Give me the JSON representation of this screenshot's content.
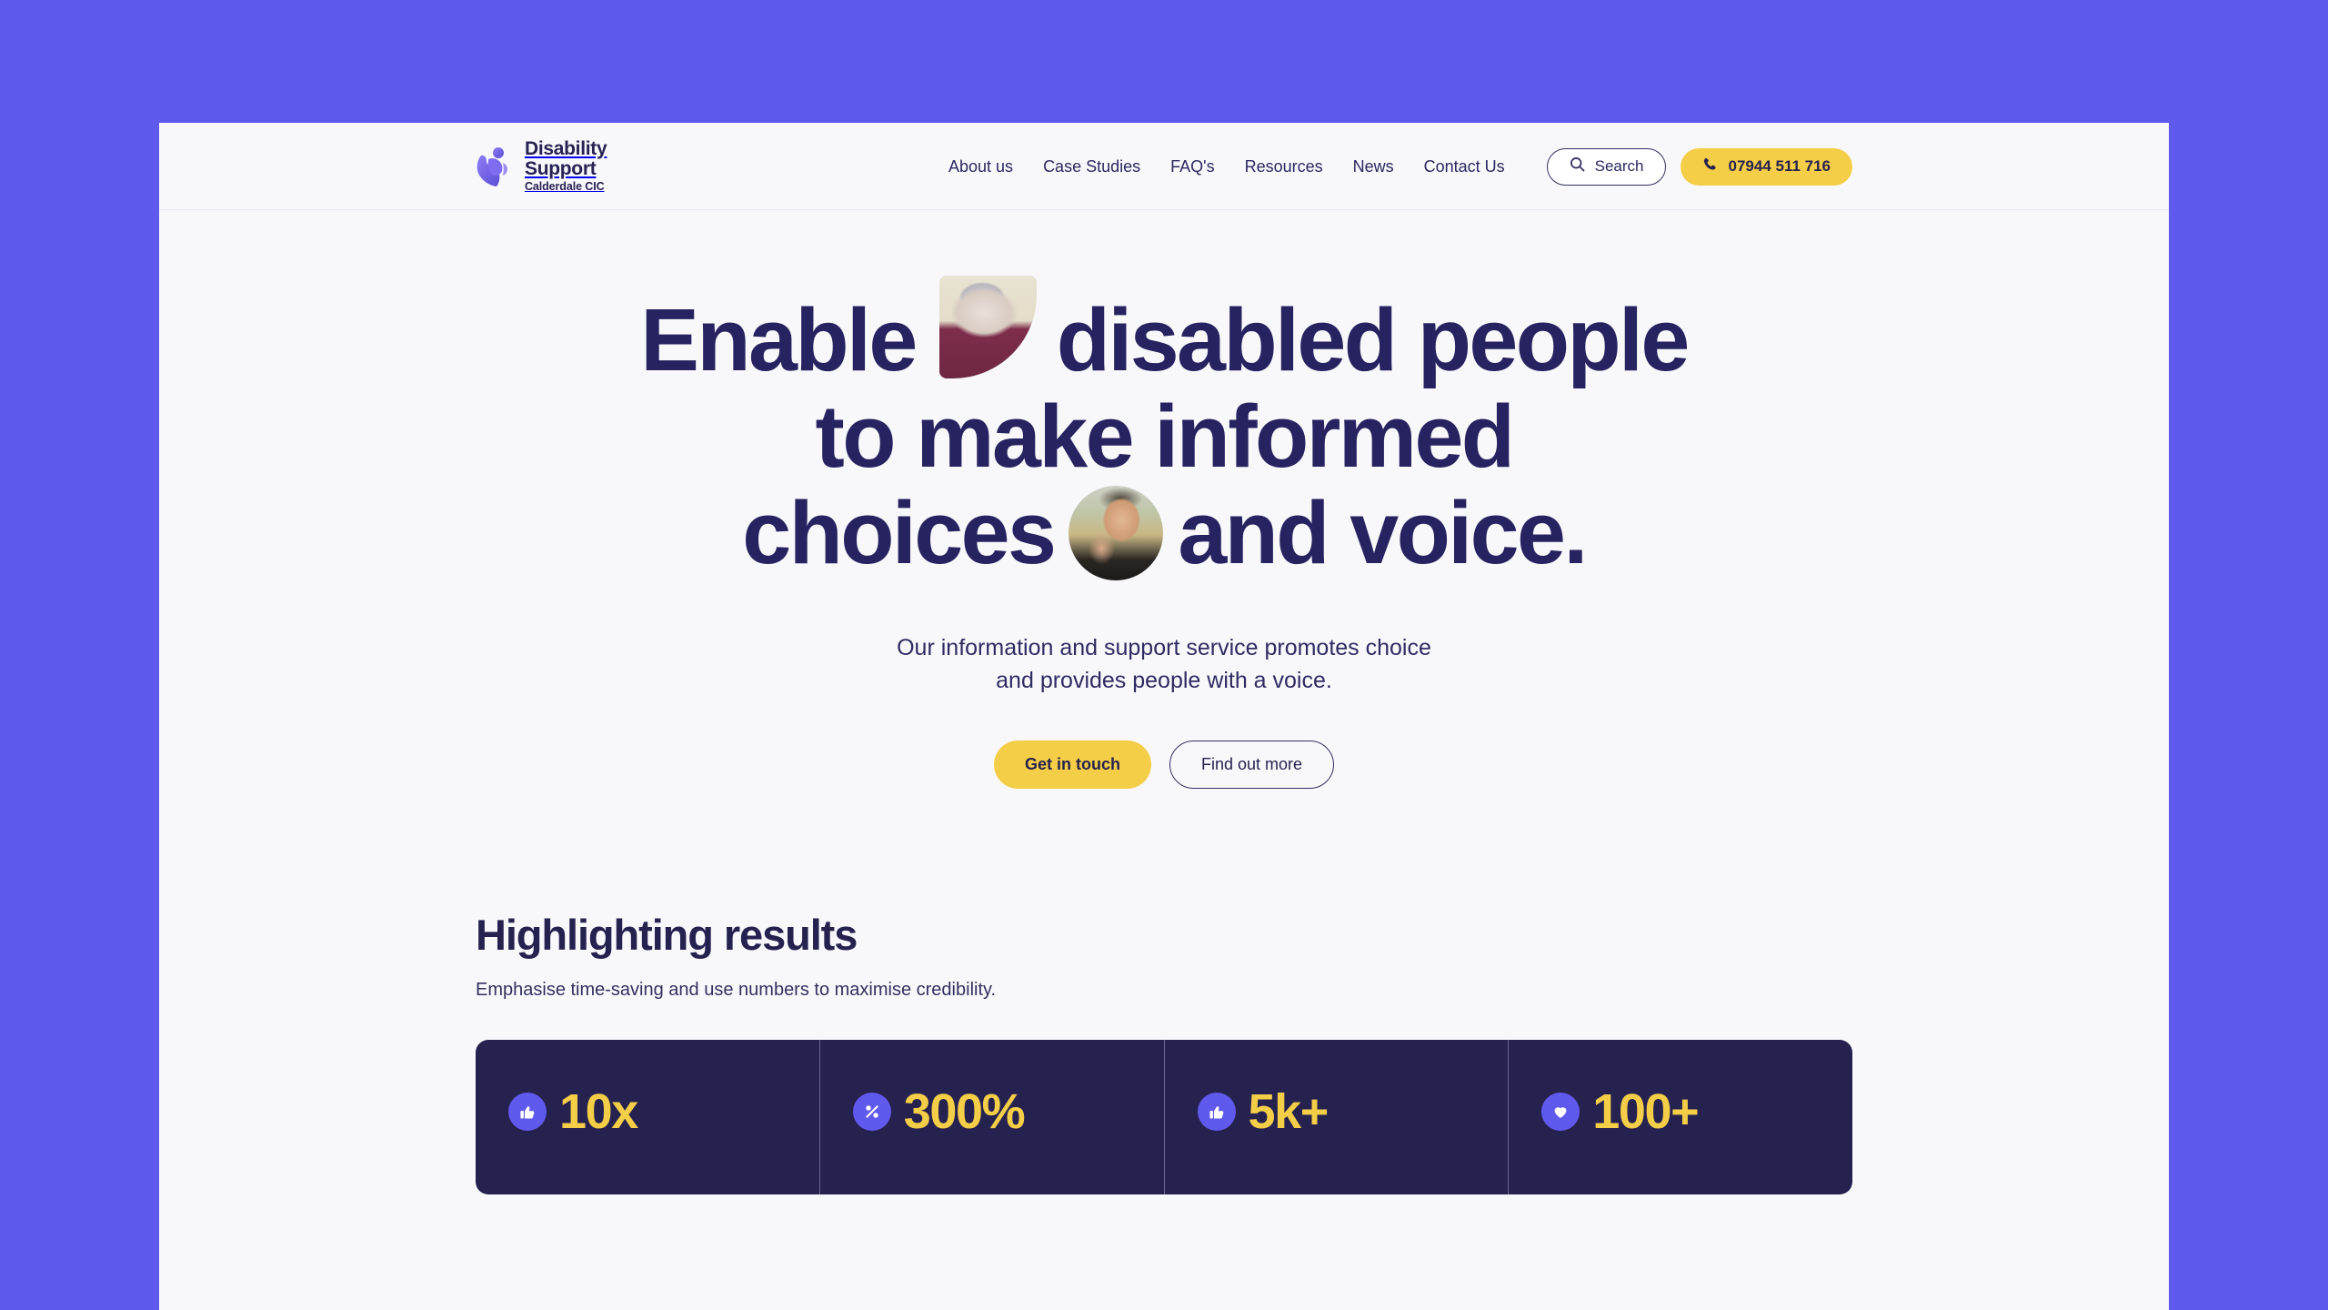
{
  "theme": {
    "page_background": "#6059ED",
    "surface": "#F8F8FB",
    "navy": "#26224F",
    "accent_yellow": "#F5CE47",
    "accent_purple": "#6059ED"
  },
  "header": {
    "logo": {
      "line1": "Disability",
      "line2": "Support",
      "line3": "Calderdale CIC",
      "icon": "hand-heart-logo-icon"
    },
    "nav": [
      {
        "label": "About us"
      },
      {
        "label": "Case Studies"
      },
      {
        "label": "FAQ's"
      },
      {
        "label": "Resources"
      },
      {
        "label": "News"
      },
      {
        "label": "Contact Us"
      }
    ],
    "search": {
      "label": "Search",
      "icon": "search-icon"
    },
    "phone": {
      "label": "07944 511 716",
      "icon": "phone-icon"
    }
  },
  "hero": {
    "heading": {
      "line1_a": "Enable",
      "line1_b": "disabled people",
      "line2": "to make informed",
      "line3_a": "choices",
      "line3_b": "and voice."
    },
    "images": [
      {
        "name": "elderly-woman-photo",
        "shape": "leaf"
      },
      {
        "name": "mother-and-son-photo",
        "shape": "arch"
      },
      {
        "name": "father-and-daughter-photo",
        "shape": "circle"
      }
    ],
    "subtitle_line1": "Our information and support service promotes choice",
    "subtitle_line2": "and provides people with a voice.",
    "cta_primary": "Get in touch",
    "cta_secondary": "Find out more"
  },
  "results": {
    "title": "Highlighting results",
    "subtitle": "Emphasise time-saving and use numbers to maximise credibility.",
    "stats": [
      {
        "value": "10x",
        "icon": "thumbs-up-icon"
      },
      {
        "value": "300%",
        "icon": "percent-icon"
      },
      {
        "value": "5k+",
        "icon": "thumbs-up-icon"
      },
      {
        "value": "100+",
        "icon": "heart-icon"
      }
    ]
  }
}
